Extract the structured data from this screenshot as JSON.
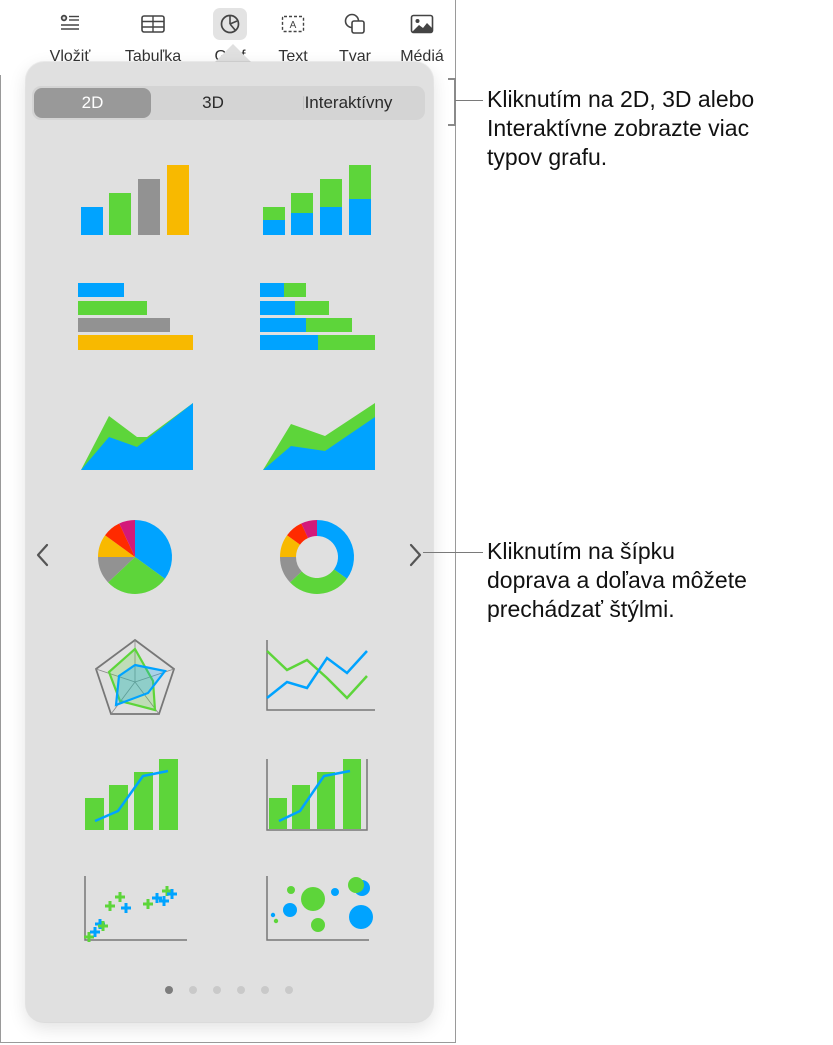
{
  "toolbar": {
    "items": [
      {
        "label": "Vložiť",
        "icon": "insert-icon"
      },
      {
        "label": "Tabuľka",
        "icon": "table-icon"
      },
      {
        "label": "Graf",
        "icon": "chart-icon",
        "active": true
      },
      {
        "label": "Text",
        "icon": "text-box-icon"
      },
      {
        "label": "Tvar",
        "icon": "shape-icon"
      },
      {
        "label": "Médiá",
        "icon": "media-icon"
      }
    ]
  },
  "chart_popover": {
    "segments": [
      {
        "label": "2D",
        "selected": true
      },
      {
        "label": "3D",
        "selected": false
      },
      {
        "label": "Interaktívny",
        "selected": false
      }
    ],
    "chart_types": [
      "column",
      "stacked-column",
      "bar",
      "stacked-bar",
      "area",
      "stacked-area",
      "pie",
      "donut",
      "radar",
      "line",
      "mixed",
      "two-axis",
      "scatter",
      "bubble"
    ],
    "nav": {
      "prev": "chevron-left-icon",
      "next": "chevron-right-icon"
    },
    "page_dots": {
      "total": 6,
      "current": 1
    }
  },
  "colors": {
    "blue": "#00a3ff",
    "green": "#5dd53a",
    "gray": "#929292",
    "yellow": "#f8b900",
    "red": "#ff2a00",
    "magenta": "#d3197a",
    "axis": "#7a7a7a"
  },
  "callouts": [
    {
      "text_lines": [
        "Kliknutím na 2D, 3D alebo",
        "Interaktívne zobrazte viac",
        "typov grafu."
      ]
    },
    {
      "text_lines": [
        "Kliknutím na šípku",
        "doprava a doľava môžete",
        "prechádzať štýlmi."
      ]
    }
  ]
}
